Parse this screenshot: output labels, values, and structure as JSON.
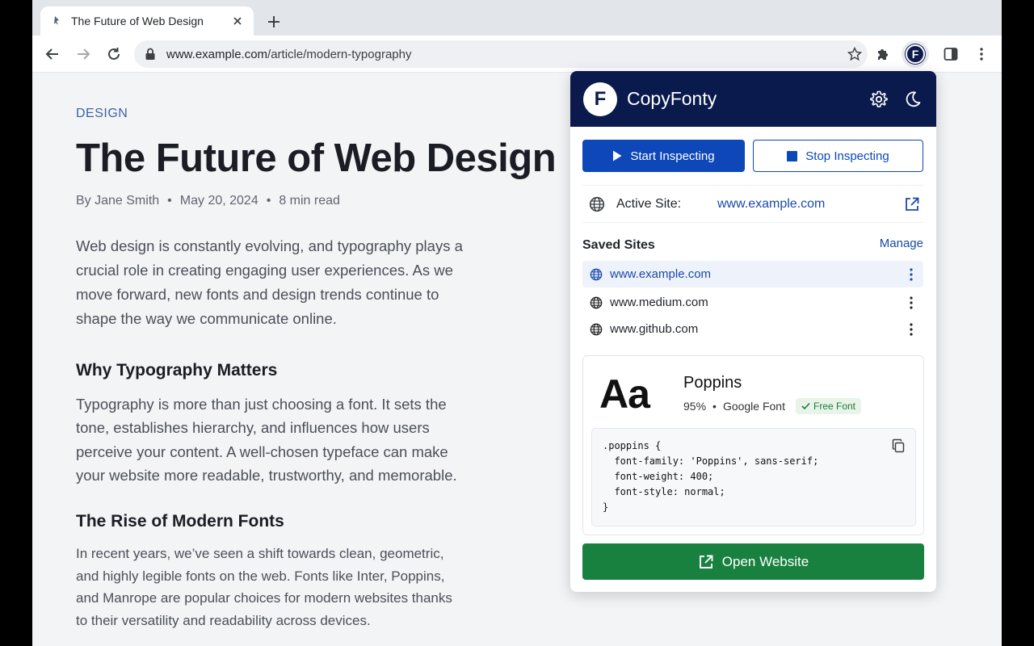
{
  "browser": {
    "tab_title": "The Future of Web Design",
    "url_host": "www.example.com",
    "url_path": "/article/modern-typography"
  },
  "article": {
    "category": "DESIGN",
    "headline": "The Future of Web Design",
    "author": "By Jane Smith",
    "date": "May 20, 2024",
    "read_time": "8 min read",
    "intro": "Web design is constantly evolving, and typography plays a crucial role in creating engaging user experiences. As we move forward, new fonts and design trends continue to shape the way we communicate online.",
    "section1_heading": "Why Typography Matters",
    "section1_text": "Typography is more than just choosing a font. It sets the tone, establishes hierarchy, and influences how users perceive your content. A well-chosen typeface can make your website more readable, trustworthy, and memorable.",
    "section2_heading": "The Rise of Modern Fonts",
    "section2_text": "In recent years, we’ve seen a shift towards clean, geometric, and highly legible fonts on the web. Fonts like Inter, Poppins, and Manrope are popular choices for modern websites thanks to their versatility and readability across devices."
  },
  "extension": {
    "logo_letter": "F",
    "name": "CopyFonty",
    "start_label": "Start Inspecting",
    "stop_label": "Stop Inspecting",
    "active_site_label": "Active Site:",
    "active_site_value": "www.example.com",
    "saved_sites_title": "Saved Sites",
    "manage_label": "Manage",
    "saved_sites": [
      {
        "name": "www.example.com",
        "selected": true
      },
      {
        "name": "www.medium.com",
        "selected": false
      },
      {
        "name": "www.github.com",
        "selected": false
      }
    ],
    "font": {
      "preview": "Aa",
      "name": "Poppins",
      "match": "95%",
      "source": "Google Font",
      "badge": "Free Font",
      "css": ".poppins {\n  font-family: 'Poppins', sans-serif;\n  font-weight: 400;\n  font-style: normal;\n}"
    },
    "open_label": "Open Website"
  },
  "colors": {
    "header_bg": "#0a1a4c",
    "primary": "#0d47b8",
    "open_button": "#19813f"
  }
}
